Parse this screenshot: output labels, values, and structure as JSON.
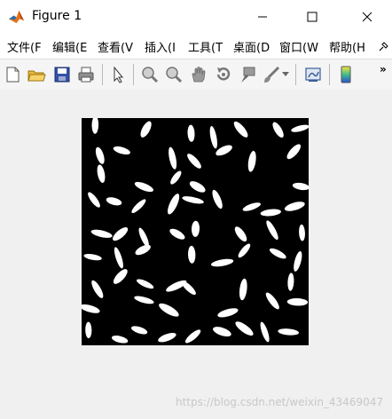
{
  "window": {
    "title": "Figure 1"
  },
  "menu": {
    "items": [
      "文件(F",
      "编辑(E",
      "查看(V",
      "插入(I",
      "工具(T",
      "桌面(D",
      "窗口(W",
      "帮助(H"
    ]
  },
  "toolbar": {
    "icons": [
      "new-figure-icon",
      "open-file-icon",
      "save-icon",
      "print-icon",
      "edit-plot-arrow-icon",
      "zoom-in-icon",
      "zoom-out-icon",
      "pan-hand-icon",
      "rotate-3d-icon",
      "data-cursor-icon",
      "brush-icon",
      "link-plot-icon",
      "colorbar-icon"
    ],
    "overflow": "»"
  },
  "watermark": "https://blog.csdn.net/weixin_43469047",
  "colors": {
    "titlebar": "#ffffff",
    "background": "#f0f0f0",
    "image_background": "#000000",
    "grains": "#ffffff"
  }
}
